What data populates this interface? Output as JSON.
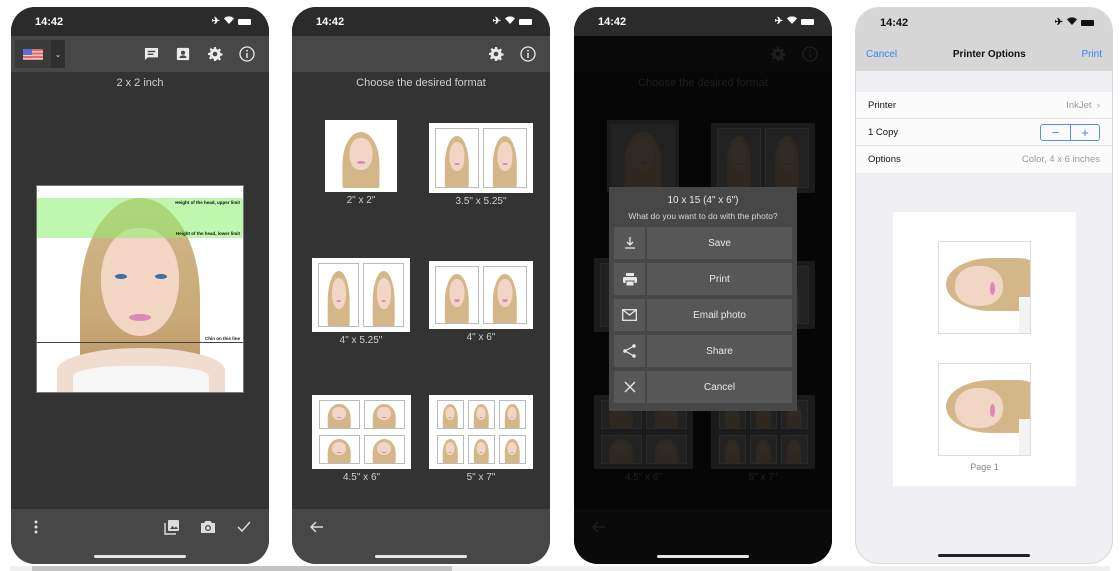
{
  "status_bar": {
    "time": "14:42",
    "icons": [
      "airplane-icon",
      "wifi-icon",
      "battery-icon"
    ]
  },
  "screen1": {
    "country_flag": "US flag",
    "toolbar_icons": [
      "comment-icon",
      "id-card-icon",
      "gear-icon",
      "info-icon"
    ],
    "format_title": "2 x 2 inch",
    "guides": {
      "upper": "Height of the head, upper limit",
      "lower": "Height of the head, lower limit",
      "chin": "Chin on this line"
    },
    "bottom_icons": [
      "more-vertical-icon",
      "gallery-icon",
      "camera-icon",
      "checkmark-icon"
    ]
  },
  "screen2": {
    "title": "Choose the desired format",
    "formats": [
      {
        "label": "2\" x 2\"",
        "photos": 1
      },
      {
        "label": "3.5\" x 5.25\"",
        "photos": 2
      },
      {
        "label": "4\" x 5.25\"",
        "photos": 2
      },
      {
        "label": "4\" x 6\"",
        "photos": 2
      },
      {
        "label": "4.5\" x 6\"",
        "photos": 4
      },
      {
        "label": "5\" x 7\"",
        "photos": 6
      }
    ],
    "back_icon": "arrow-left-icon"
  },
  "screen3": {
    "dialog": {
      "title": "10 x 15 (4\" x 6\")",
      "subtitle": "What do you want to do with the photo?",
      "actions": [
        {
          "icon": "download-icon",
          "label": "Save"
        },
        {
          "icon": "printer-icon",
          "label": "Print"
        },
        {
          "icon": "mail-icon",
          "label": "Email photo"
        },
        {
          "icon": "share-icon",
          "label": "Share"
        },
        {
          "icon": "close-icon",
          "label": "Cancel"
        }
      ]
    }
  },
  "screen4": {
    "nav": {
      "cancel": "Cancel",
      "title": "Printer Options",
      "print": "Print"
    },
    "options": {
      "printer_label": "Printer",
      "printer_value": "InkJet",
      "copies_label": "1 Copy",
      "options_label": "Options",
      "options_value": "Color, 4 x 6 inches"
    },
    "stepper": {
      "minus": "−",
      "plus": "+"
    },
    "page_label": "Page 1"
  },
  "colors": {
    "ios_blue": "#3b82f6",
    "dark_bg": "#333333",
    "toolbar": "#474747",
    "guide_green": "#8cf06e"
  }
}
